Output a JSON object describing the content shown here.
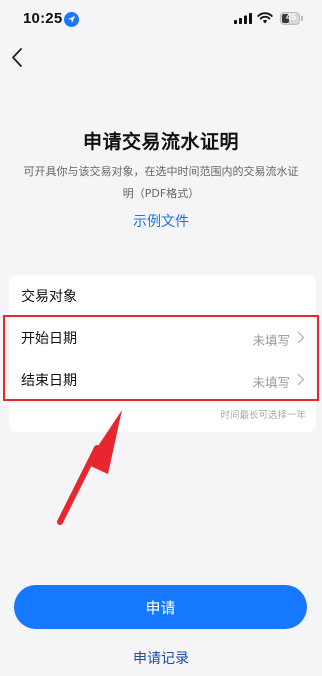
{
  "status_bar": {
    "time": "10:25",
    "battery": "45",
    "battery_level": 0.45
  },
  "header": {
    "title": "申请交易流水证明",
    "description": "可开具你与该交易对象，在选中时间范围内的交易流水证明（PDF格式）",
    "example_link": "示例文件"
  },
  "form": {
    "transaction_party_label": "交易对象",
    "start_date_label": "开始日期",
    "start_date_value": "未填写",
    "end_date_label": "结束日期",
    "end_date_value": "未填写",
    "hint": "时间最长可选择一年"
  },
  "actions": {
    "apply_label": "申请",
    "records_label": "申请记录"
  },
  "colors": {
    "accent": "#1677ff",
    "annotation": "#e8262f"
  },
  "icons": [
    "location-arrow-icon",
    "signal-icon",
    "wifi-icon",
    "battery-icon",
    "back-chevron-icon",
    "chevron-right-icon"
  ]
}
